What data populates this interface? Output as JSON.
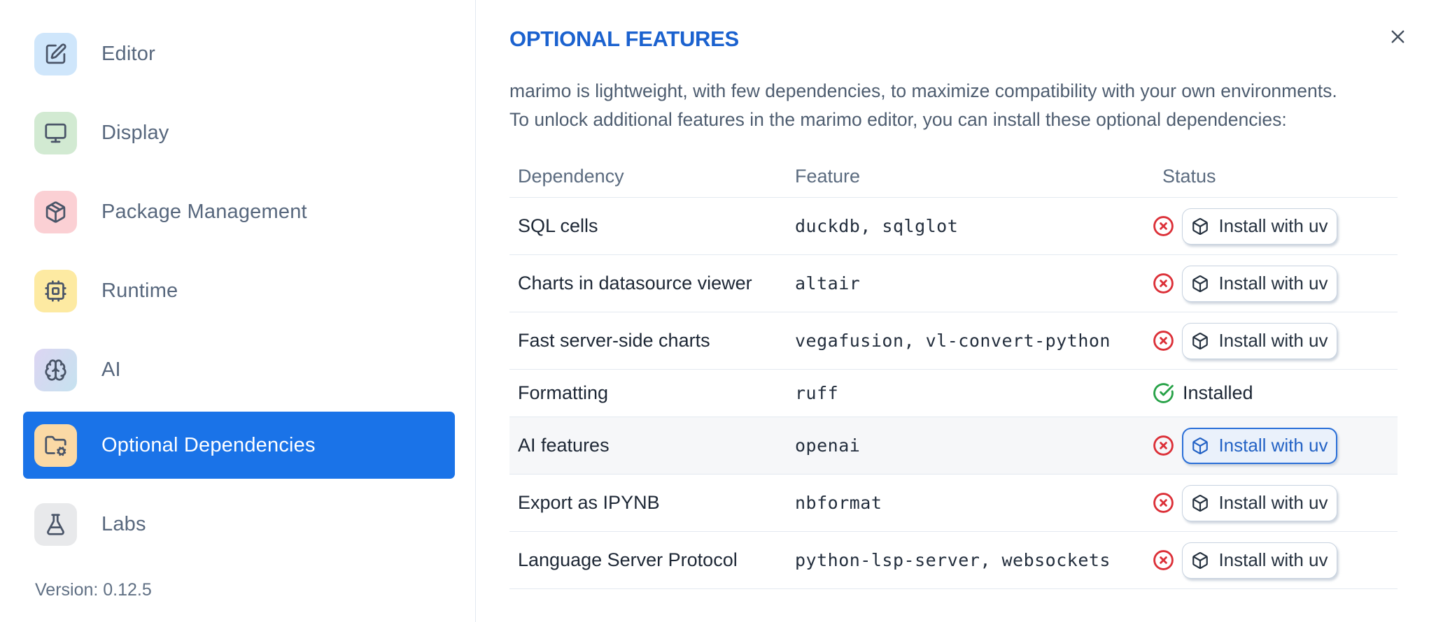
{
  "sidebar": {
    "items": [
      {
        "label": "Editor",
        "icon": "square-pen-icon"
      },
      {
        "label": "Display",
        "icon": "monitor-icon"
      },
      {
        "label": "Package Management",
        "icon": "package-icon"
      },
      {
        "label": "Runtime",
        "icon": "cpu-icon"
      },
      {
        "label": "AI",
        "icon": "brain-icon"
      },
      {
        "label": "Optional Dependencies",
        "icon": "folder-cog-icon",
        "selected": true
      },
      {
        "label": "Labs",
        "icon": "flask-icon"
      }
    ],
    "version_label": "Version: 0.12.5"
  },
  "panel": {
    "title": "OPTIONAL FEATURES",
    "description_line1": "marimo is lightweight, with few dependencies, to maximize compatibility with your own environments.",
    "description_line2": "To unlock additional features in the marimo editor, you can install these optional dependencies:"
  },
  "table": {
    "headers": [
      "Dependency",
      "Feature",
      "Status"
    ],
    "install_button_label": "Install with uv",
    "installed_label": "Installed",
    "rows": [
      {
        "dependency": "SQL cells",
        "feature": "duckdb, sqlglot",
        "status": "not-installed"
      },
      {
        "dependency": "Charts in datasource viewer",
        "feature": "altair",
        "status": "not-installed"
      },
      {
        "dependency": "Fast server-side charts",
        "feature": "vegafusion, vl-convert-python",
        "status": "not-installed"
      },
      {
        "dependency": "Formatting",
        "feature": "ruff",
        "status": "installed"
      },
      {
        "dependency": "AI features",
        "feature": "openai",
        "status": "not-installed",
        "focused": true
      },
      {
        "dependency": "Export as IPYNB",
        "feature": "nbformat",
        "status": "not-installed"
      },
      {
        "dependency": "Language Server Protocol",
        "feature": "python-lsp-server, websockets",
        "status": "not-installed"
      }
    ]
  },
  "colors": {
    "accent": "#1a73e8",
    "title_blue": "#1b62cf",
    "focus_blue": "#2a6fd8",
    "focus_bg": "#eaf1fb",
    "focus_text": "#2362c5",
    "error_red": "#dc3038",
    "success_green": "#28a248",
    "icon_editor_bg": "#cfe6fb",
    "icon_display_bg": "#d2ead2",
    "icon_package_bg": "#fbd0d4",
    "icon_runtime_bg": "#fdeaa2",
    "icon_ai_bg_start": "#dcd5f2",
    "icon_ai_bg_end": "#c6e2ef",
    "icon_optdeps_bg": "#fbd9a5",
    "icon_labs_bg": "#e8e9eb"
  }
}
